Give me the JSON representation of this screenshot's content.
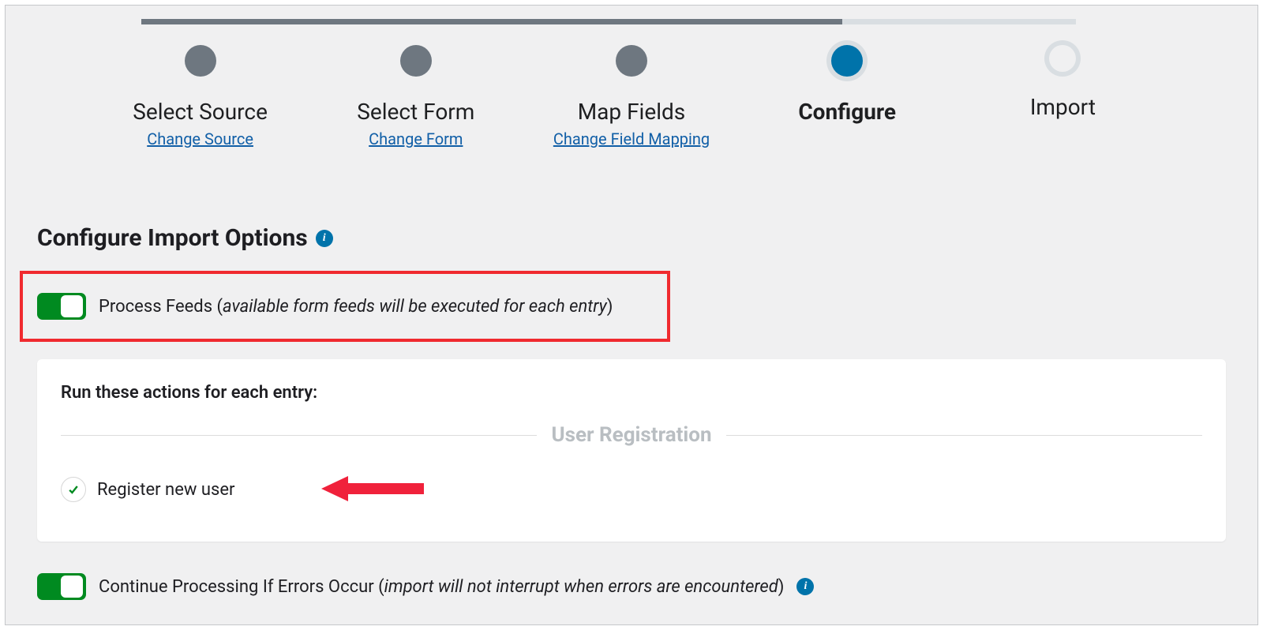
{
  "stepper": {
    "steps": [
      {
        "label": "Select Source",
        "link": "Change Source",
        "state": "done"
      },
      {
        "label": "Select Form",
        "link": "Change Form",
        "state": "done"
      },
      {
        "label": "Map Fields",
        "link": "Change Field Mapping",
        "state": "done"
      },
      {
        "label": "Configure",
        "link": "",
        "state": "active"
      },
      {
        "label": "Import",
        "link": "",
        "state": "future"
      }
    ]
  },
  "section": {
    "title": "Configure Import Options"
  },
  "process_feeds": {
    "label": "Process Feeds ",
    "sub_open": "(",
    "sub_text": "available form feeds will be executed for each entry",
    "sub_close": ")",
    "enabled": true
  },
  "card": {
    "title": "Run these actions for each entry:",
    "divider": "User Registration",
    "action": {
      "label": "Register new user",
      "checked": true
    }
  },
  "continue_errors": {
    "label": "Continue Processing If Errors Occur ",
    "sub_open": "(",
    "sub_text": "import will not interrupt when errors are encountered",
    "sub_close": ")",
    "enabled": true
  }
}
